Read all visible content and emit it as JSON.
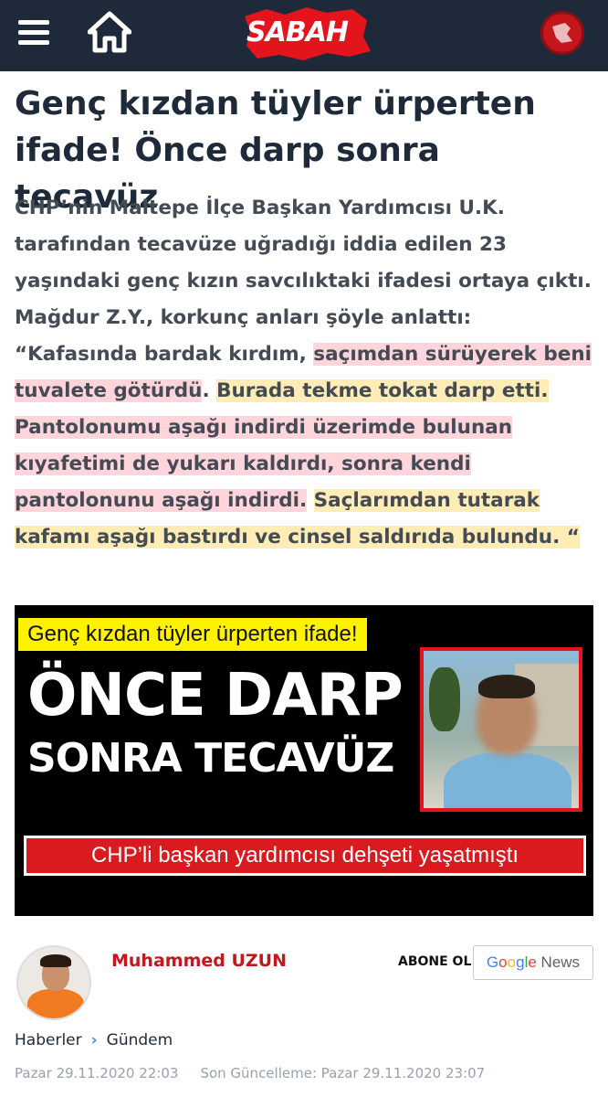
{
  "header": {
    "logo_text": "SABAH",
    "icons": {
      "menu": "hamburger-menu-icon",
      "home": "home-icon",
      "badge": "team-badge-icon"
    },
    "colors": {
      "bar": "#1e2a3a",
      "logo_red": "#e3141b"
    }
  },
  "article": {
    "title": "Genç kızdan tüyler ürperten ifade! Önce darp sonra tecavüz",
    "body": {
      "p1": "CHP’nin Maltepe İlçe Başkan Yardımcısı U.K. tarafından tecavüze uğradığı iddia edilen 23 yaşındaki genç kızın savcılıktaki ifadesi ortaya çıktı. Mağdur Z.Y., korkunç anları şöyle anlattı: “Kafasında bardak kırdım, ",
      "hl1": "saçımdan sürüyerek beni tuvalete götürdü",
      "t2": ". ",
      "hl2": "Burada tekme tokat darp etti.",
      "t3": " ",
      "hl3": "Pantolonumu aşağı indirdi üzerimde bulunan kıyafetimi de yukarı kaldırdı, sonra kendi pantolonunu aşağı indirdi.",
      "t4": " ",
      "hl4": "Saçlarımdan tutarak kafamı aşağı bastırdı ve cinsel saldırıda bulundu. “"
    },
    "image": {
      "top_banner": "Genç kızdan tüyler ürperten ifade!",
      "headline1": "ÖNCE DARP",
      "headline2": "SONRA TECAVÜZ",
      "bottom_banner": "CHP’li başkan yardımcısı dehşeti yaşatmıştı"
    }
  },
  "author": {
    "name": "Muhammed UZUN",
    "subscribe_label": "ABONE OL",
    "gnews": {
      "G": "G",
      "o1": "o",
      "o2": "o",
      "g": "g",
      "l": "l",
      "e": "e",
      "news": "News"
    }
  },
  "breadcrumb": {
    "item1": "Haberler",
    "separator": "›",
    "item2": "Gündem"
  },
  "dates": {
    "published": "Pazar 29.11.2020 22:03",
    "updated": "Son Güncelleme: Pazar 29.11.2020 23:07"
  }
}
